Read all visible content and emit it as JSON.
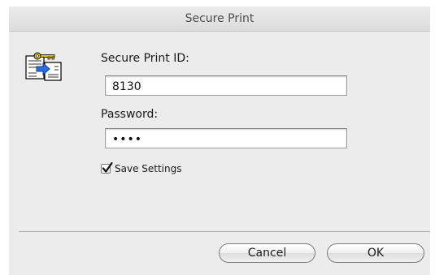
{
  "dialog": {
    "title": "Secure Print",
    "icon": "secure-print-key-document-icon",
    "secure_print_id_label": "Secure Print ID:",
    "secure_print_id_value": "8130",
    "password_label": "Password:",
    "password_value": "••••",
    "save_settings_label": "Save Settings",
    "save_settings_checked": true,
    "cancel_label": "Cancel",
    "ok_label": "OK"
  }
}
